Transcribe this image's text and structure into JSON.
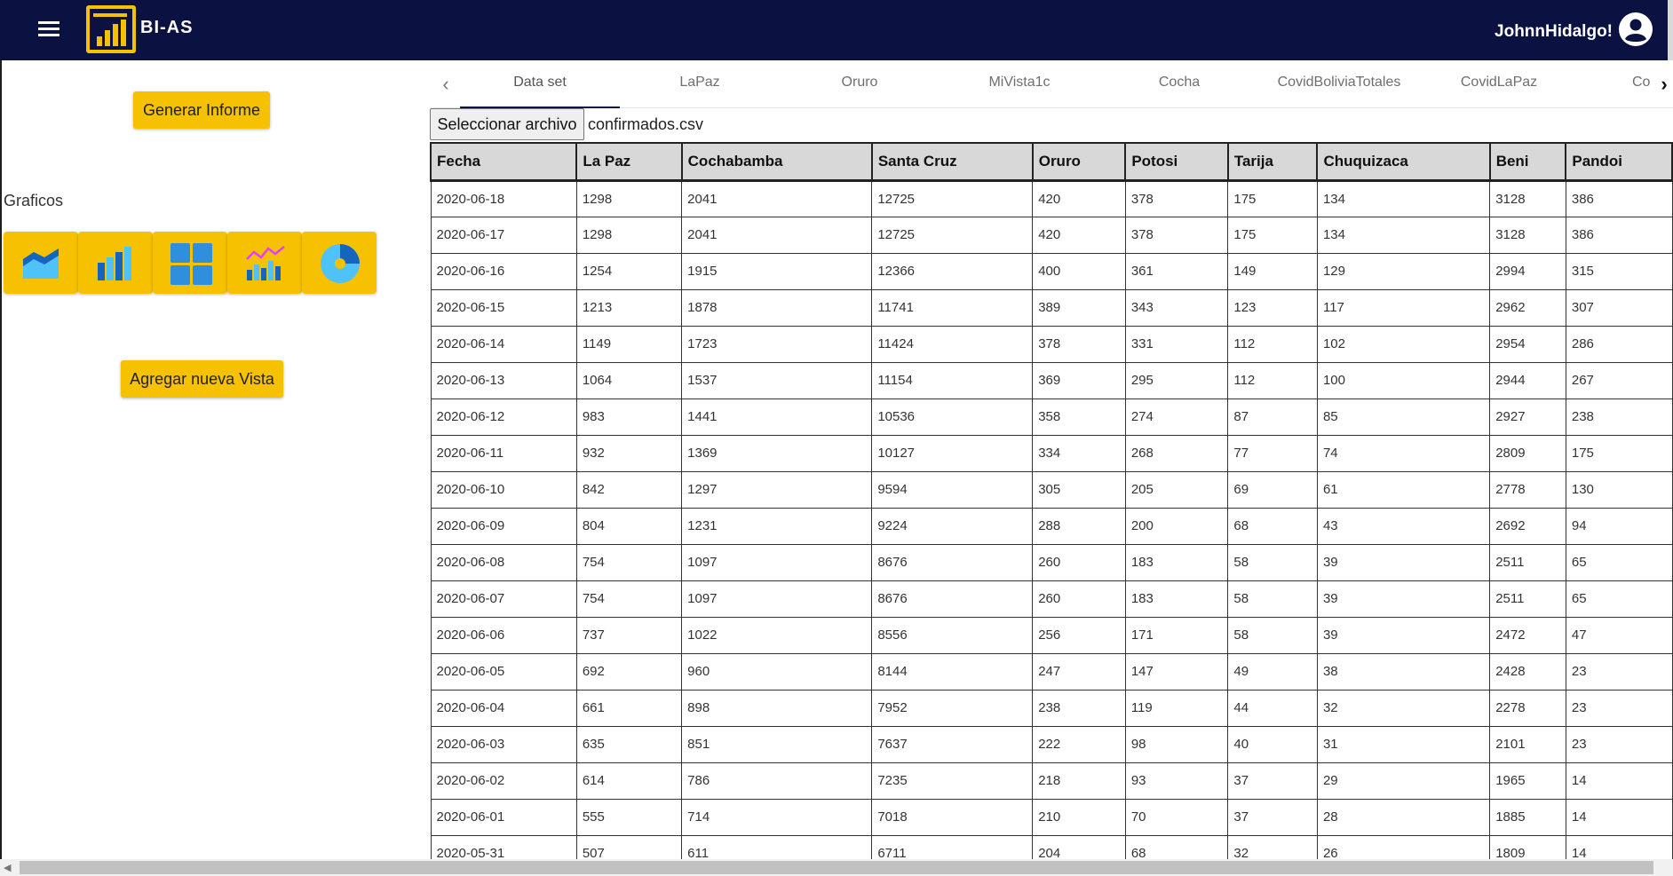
{
  "app": {
    "name": "BI-AS",
    "user_greeting": "JohnnHidalgo!",
    "colors": {
      "appbar": "#0b1141",
      "accent": "#f5c100",
      "icon_blue": "#4fc3f7"
    }
  },
  "sidebar": {
    "generate_report_label": "Generar Informe",
    "charts_label": "Graficos",
    "chart_icons": [
      "area-chart-icon",
      "bar-chart-icon",
      "grid-dashboard-icon",
      "combo-chart-icon",
      "pie-chart-icon"
    ],
    "add_view_label": "Agregar nueva Vista"
  },
  "tabs": {
    "items": [
      {
        "label": "Data set",
        "active": true
      },
      {
        "label": "LaPaz"
      },
      {
        "label": "Oruro"
      },
      {
        "label": "MiVista1c"
      },
      {
        "label": "Cocha"
      },
      {
        "label": "CovidBoliviaTotales"
      },
      {
        "label": "CovidLaPaz"
      },
      {
        "label": "Co"
      }
    ],
    "prev_icon": "chevron-left-icon",
    "next_icon": "chevron-right-icon"
  },
  "file": {
    "button_label": "Seleccionar archivo",
    "selected_name": "confirmados.csv"
  },
  "table": {
    "headers": [
      "Fecha",
      "La Paz",
      "Cochabamba",
      "Santa Cruz",
      "Oruro",
      "Potosi",
      "Tarija",
      "Chuquizaca",
      "Beni",
      "Pandoi"
    ],
    "rows": [
      [
        "2020-06-18",
        "1298",
        "2041",
        "12725",
        "420",
        "378",
        "175",
        "134",
        "3128",
        "386"
      ],
      [
        "2020-06-17",
        "1298",
        "2041",
        "12725",
        "420",
        "378",
        "175",
        "134",
        "3128",
        "386"
      ],
      [
        "2020-06-16",
        "1254",
        "1915",
        "12366",
        "400",
        "361",
        "149",
        "129",
        "2994",
        "315"
      ],
      [
        "2020-06-15",
        "1213",
        "1878",
        "11741",
        "389",
        "343",
        "123",
        "117",
        "2962",
        "307"
      ],
      [
        "2020-06-14",
        "1149",
        "1723",
        "11424",
        "378",
        "331",
        "112",
        "102",
        "2954",
        "286"
      ],
      [
        "2020-06-13",
        "1064",
        "1537",
        "11154",
        "369",
        "295",
        "112",
        "100",
        "2944",
        "267"
      ],
      [
        "2020-06-12",
        "983",
        "1441",
        "10536",
        "358",
        "274",
        "87",
        "85",
        "2927",
        "238"
      ],
      [
        "2020-06-11",
        "932",
        "1369",
        "10127",
        "334",
        "268",
        "77",
        "74",
        "2809",
        "175"
      ],
      [
        "2020-06-10",
        "842",
        "1297",
        "9594",
        "305",
        "205",
        "69",
        "61",
        "2778",
        "130"
      ],
      [
        "2020-06-09",
        "804",
        "1231",
        "9224",
        "288",
        "200",
        "68",
        "43",
        "2692",
        "94"
      ],
      [
        "2020-06-08",
        "754",
        "1097",
        "8676",
        "260",
        "183",
        "58",
        "39",
        "2511",
        "65"
      ],
      [
        "2020-06-07",
        "754",
        "1097",
        "8676",
        "260",
        "183",
        "58",
        "39",
        "2511",
        "65"
      ],
      [
        "2020-06-06",
        "737",
        "1022",
        "8556",
        "256",
        "171",
        "58",
        "39",
        "2472",
        "47"
      ],
      [
        "2020-06-05",
        "692",
        "960",
        "8144",
        "247",
        "147",
        "49",
        "38",
        "2428",
        "23"
      ],
      [
        "2020-06-04",
        "661",
        "898",
        "7952",
        "238",
        "119",
        "44",
        "32",
        "2278",
        "23"
      ],
      [
        "2020-06-03",
        "635",
        "851",
        "7637",
        "222",
        "98",
        "40",
        "31",
        "2101",
        "23"
      ],
      [
        "2020-06-02",
        "614",
        "786",
        "7235",
        "218",
        "93",
        "37",
        "29",
        "1965",
        "14"
      ],
      [
        "2020-06-01",
        "555",
        "714",
        "7018",
        "210",
        "70",
        "37",
        "28",
        "1885",
        "14"
      ],
      [
        "2020-05-31",
        "507",
        "611",
        "6711",
        "204",
        "68",
        "32",
        "26",
        "1809",
        "14"
      ]
    ]
  }
}
